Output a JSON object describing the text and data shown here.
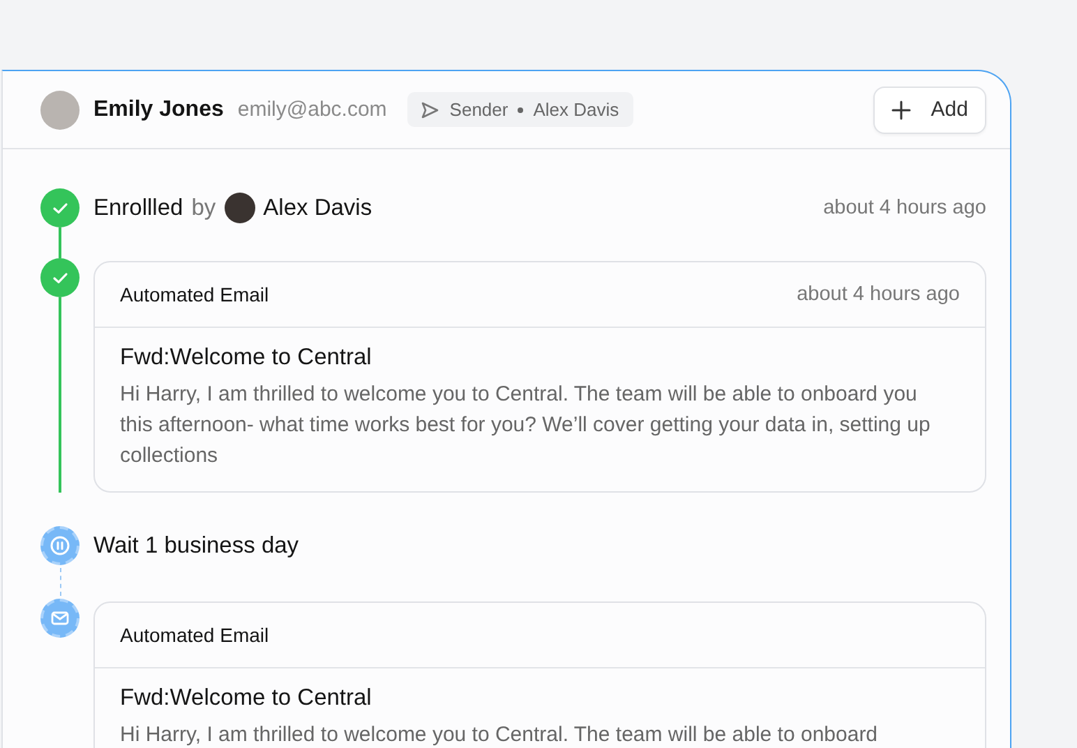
{
  "header": {
    "contact_name": "Emily Jones",
    "contact_email": "emily@abc.com",
    "sender_chip": {
      "label": "Sender",
      "name": "Alex Davis"
    },
    "add_button": "Add"
  },
  "steps": [
    {
      "kind": "event",
      "done": true,
      "label": "Enrollled",
      "by": "by",
      "actor": "Alex Davis",
      "time": "about 4 hours ago"
    },
    {
      "kind": "email",
      "done": true,
      "card_title": "Automated Email",
      "time": "about 4 hours ago",
      "subject": "Fwd:Welcome to Central",
      "body": "Hi Harry, I am thrilled to welcome you to Central. The team will be able to onboard you this afternoon- what time works best for you? We’ll cover getting your data in, setting up collections"
    },
    {
      "kind": "wait",
      "done": false,
      "label": "Wait 1 business day"
    },
    {
      "kind": "email",
      "done": false,
      "card_title": "Automated Email",
      "subject": "Fwd:Welcome to Central",
      "body": "Hi Harry, I am thrilled to welcome you to Central. The team will be able to onboard"
    }
  ]
}
